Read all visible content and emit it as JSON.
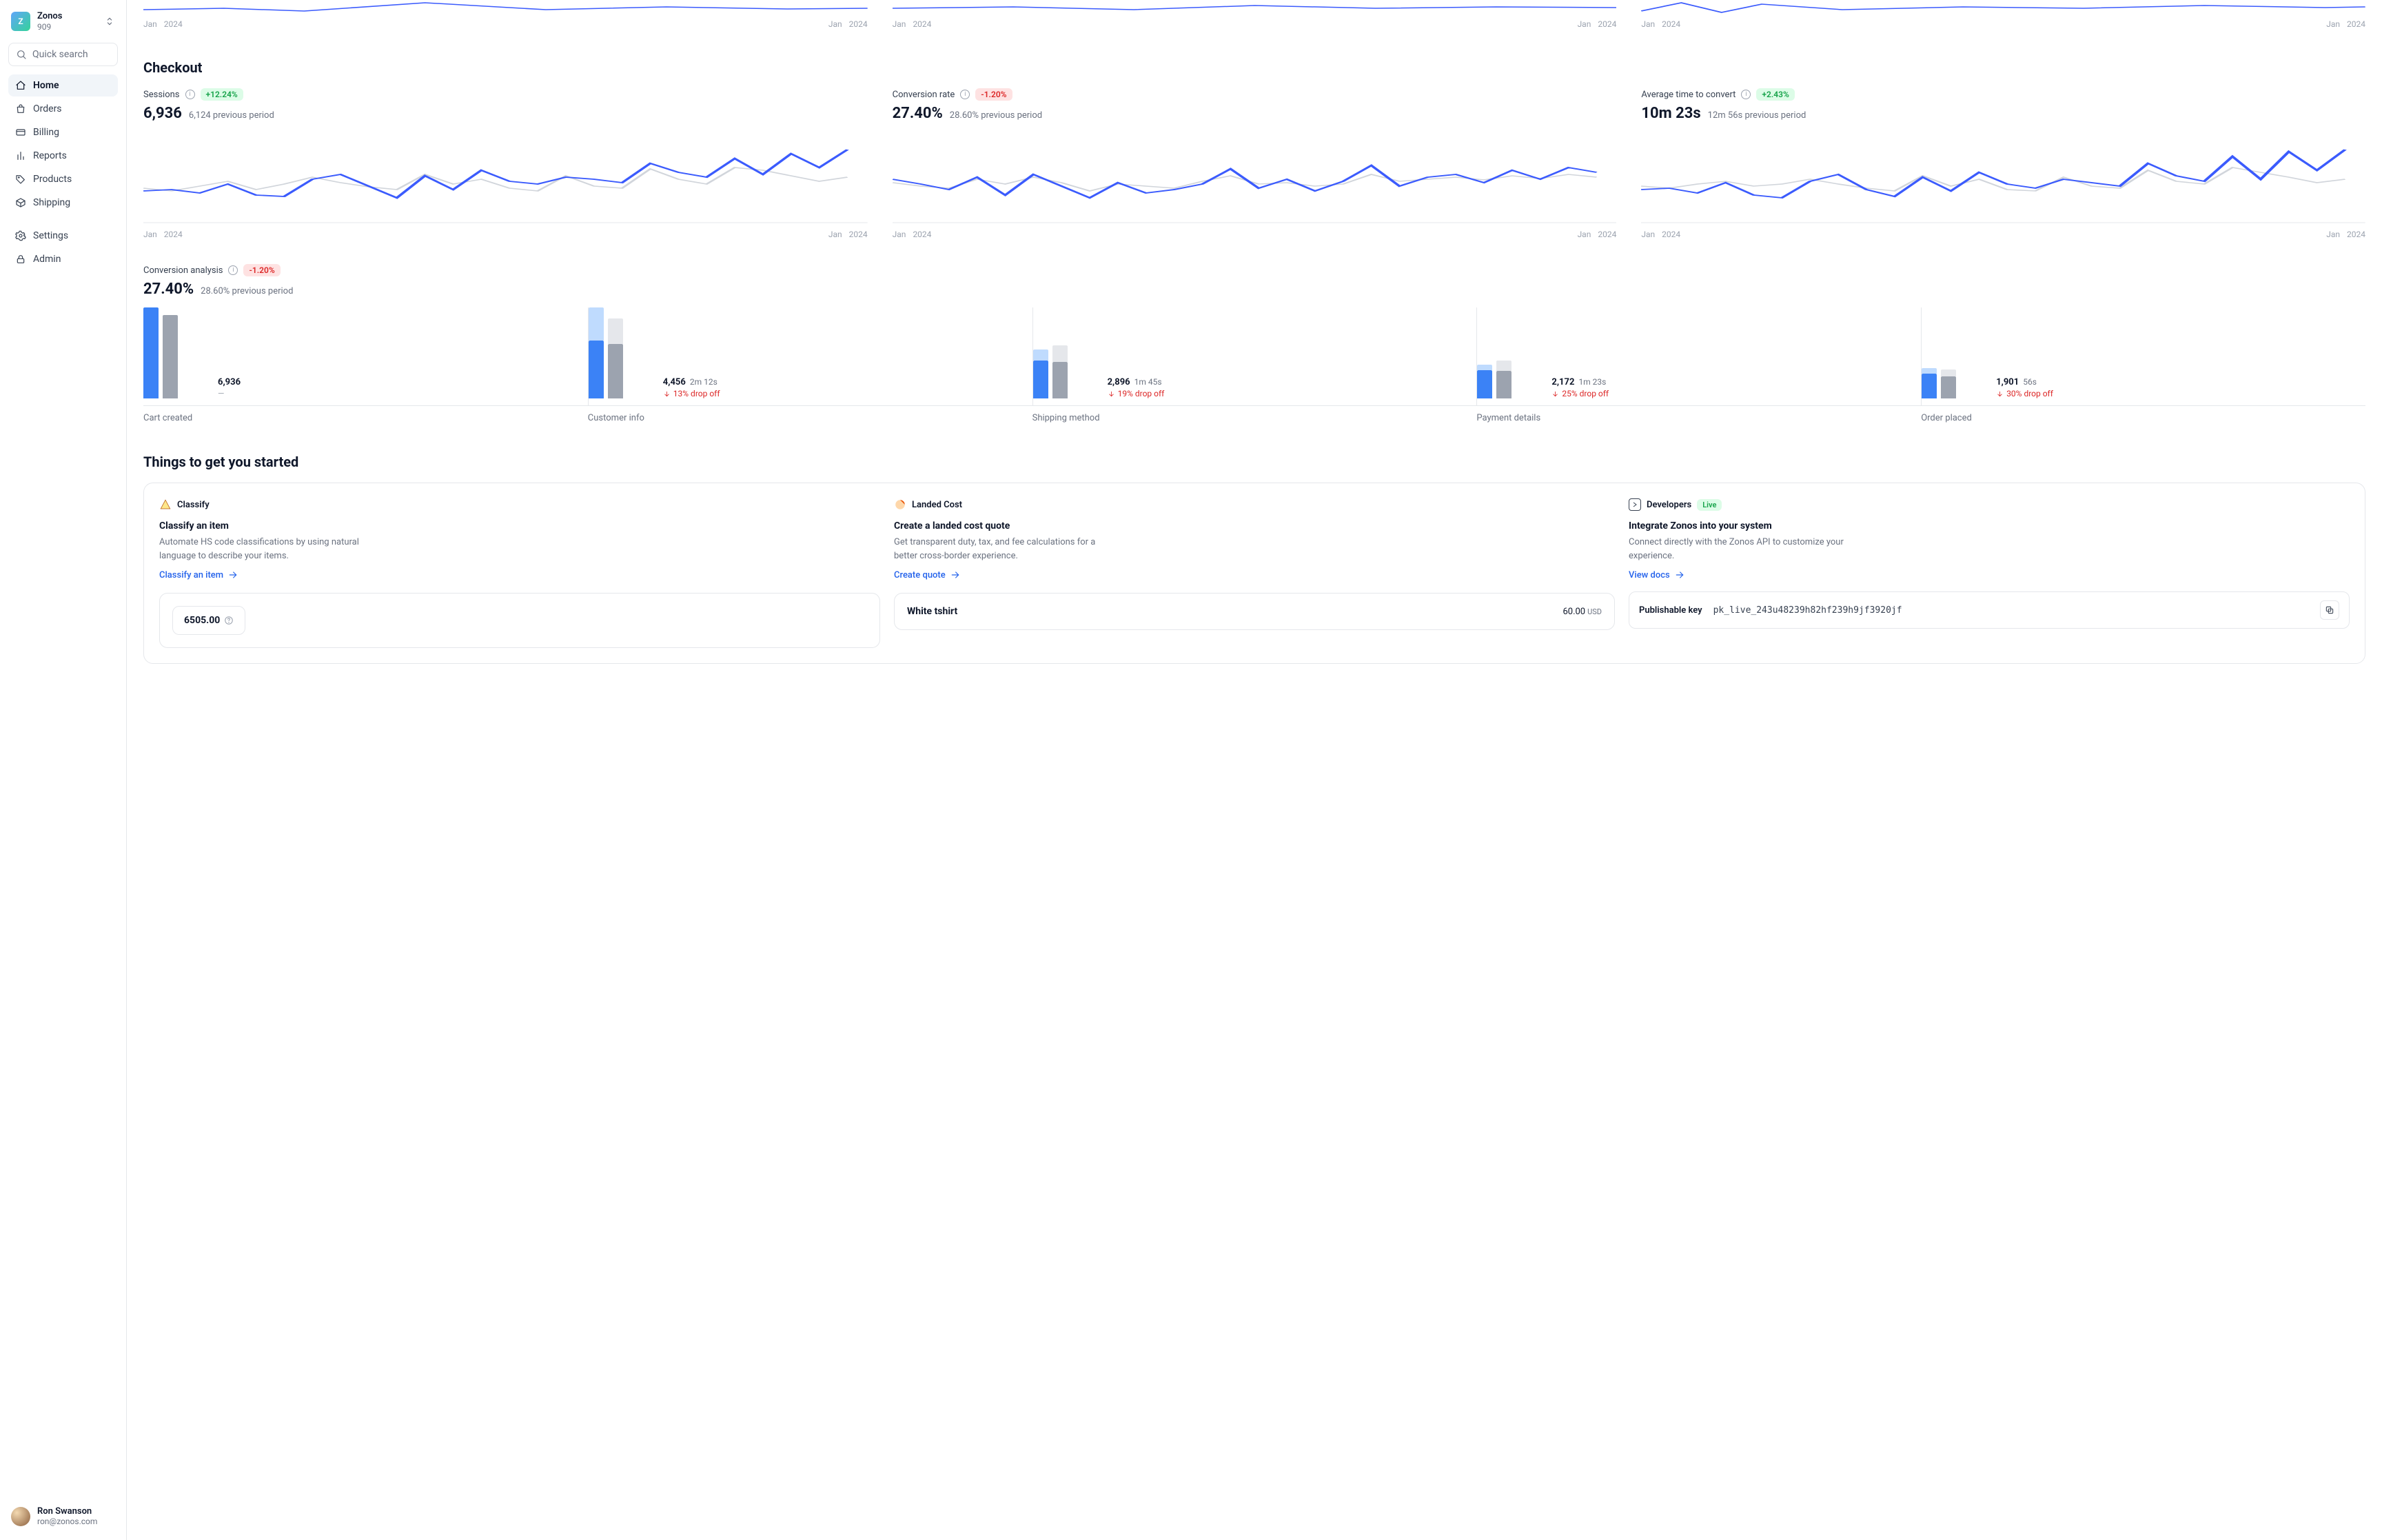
{
  "org": {
    "name": "Zonos",
    "id": "909",
    "initial": "Z"
  },
  "search": {
    "placeholder": "Quick search"
  },
  "nav": {
    "home": "Home",
    "orders": "Orders",
    "billing": "Billing",
    "reports": "Reports",
    "products": "Products",
    "shipping": "Shipping",
    "settings": "Settings",
    "admin": "Admin"
  },
  "user": {
    "name": "Ron Swanson",
    "email": "ron@zonos.com"
  },
  "dates": {
    "left_month": "Jan",
    "left_year": "2024",
    "right_month": "Jan",
    "right_year": "2024"
  },
  "checkout": {
    "title": "Checkout",
    "sessions": {
      "label": "Sessions",
      "delta": "+12.24%",
      "delta_type": "pos",
      "value": "6,936",
      "prev": "6,124 previous period"
    },
    "conversion": {
      "label": "Conversion rate",
      "delta": "-1.20%",
      "delta_type": "neg",
      "value": "27.40%",
      "prev": "28.60% previous period"
    },
    "avg_time": {
      "label": "Average time to convert",
      "delta": "+2.43%",
      "delta_type": "pos",
      "value": "10m 23s",
      "prev": "12m 56s previous period"
    }
  },
  "funnel": {
    "label": "Conversion analysis",
    "delta": "-1.20%",
    "value": "27.40%",
    "prev": "28.60% previous period",
    "steps": [
      {
        "label": "Cart created",
        "value": "6,936",
        "time": "",
        "drop": "",
        "cur_h": 100,
        "cur_top": 0,
        "prev_h": 92,
        "prev_top": 0
      },
      {
        "label": "Customer info",
        "value": "4,456",
        "time": "2m 12s",
        "drop": "13% drop off",
        "cur_h": 64,
        "cur_top": 36,
        "prev_h": 60,
        "prev_top": 28
      },
      {
        "label": "Shipping method",
        "value": "2,896",
        "time": "1m 45s",
        "drop": "19% drop off",
        "cur_h": 42,
        "cur_top": 12,
        "prev_h": 40,
        "prev_top": 18
      },
      {
        "label": "Payment details",
        "value": "2,172",
        "time": "1m 23s",
        "drop": "25% drop off",
        "cur_h": 31,
        "cur_top": 6,
        "prev_h": 30,
        "prev_top": 12
      },
      {
        "label": "Order placed",
        "value": "1,901",
        "time": "56s",
        "drop": "30% drop off",
        "cur_h": 27,
        "cur_top": 6,
        "prev_h": 24,
        "prev_top": 8
      }
    ]
  },
  "things": {
    "title": "Things to get you started",
    "classify": {
      "tag": "Classify",
      "title": "Classify an item",
      "desc": "Automate HS code classifications by using natural language to describe your items.",
      "link": "Classify an item",
      "preview_amount": "6505.00"
    },
    "landed": {
      "tag": "Landed Cost",
      "title": "Create a landed cost quote",
      "desc": "Get transparent duty, tax, and fee calculations for a better cross-border experience.",
      "link": "Create quote",
      "item_name": "White tshirt",
      "item_price": "60.00",
      "item_currency": "USD"
    },
    "dev": {
      "tag": "Developers",
      "live": "Live",
      "title": "Integrate Zonos into your system",
      "desc": "Connect directly with the Zonos API to customize your experience.",
      "link": "View docs",
      "key_label": "Publishable key",
      "key_value": "pk_live_243u48239h82hf239h9jf3920jf"
    }
  },
  "chart_data": [
    {
      "type": "line",
      "title": "Sessions",
      "x_range": [
        "Jan 2024",
        "Jan 2024"
      ],
      "series": [
        {
          "name": "current",
          "values": [
            38,
            40,
            35,
            48,
            32,
            30,
            55,
            62,
            45,
            28,
            60,
            40,
            68,
            52,
            48,
            58,
            55,
            50,
            78,
            65,
            58,
            85,
            62,
            92,
            72,
            98
          ]
        },
        {
          "name": "previous",
          "values": [
            42,
            38,
            45,
            52,
            40,
            48,
            58,
            50,
            44,
            40,
            62,
            48,
            55,
            42,
            38,
            60,
            45,
            42,
            70,
            55,
            48,
            72,
            68,
            60,
            52,
            58
          ]
        }
      ]
    },
    {
      "type": "line",
      "title": "Conversion rate",
      "x_range": [
        "Jan 2024",
        "Jan 2024"
      ],
      "series": [
        {
          "name": "current",
          "values": [
            55,
            48,
            40,
            58,
            32,
            62,
            45,
            28,
            50,
            35,
            40,
            48,
            70,
            42,
            55,
            38,
            52,
            75,
            45,
            58,
            62,
            50,
            68,
            55,
            72,
            65
          ]
        },
        {
          "name": "previous",
          "values": [
            50,
            45,
            42,
            55,
            48,
            58,
            50,
            38,
            48,
            45,
            42,
            52,
            60,
            48,
            50,
            45,
            48,
            62,
            52,
            55,
            58,
            54,
            60,
            56,
            62,
            58
          ]
        }
      ]
    },
    {
      "type": "line",
      "title": "Average time to convert",
      "x_range": [
        "Jan 2024",
        "Jan 2024"
      ],
      "series": [
        {
          "name": "current",
          "values": [
            40,
            42,
            35,
            50,
            32,
            28,
            52,
            62,
            40,
            30,
            58,
            38,
            65,
            48,
            42,
            55,
            50,
            45,
            78,
            60,
            52,
            88,
            55,
            95,
            68,
            98
          ]
        },
        {
          "name": "previous",
          "values": [
            45,
            42,
            48,
            52,
            45,
            48,
            55,
            48,
            42,
            38,
            60,
            45,
            55,
            40,
            38,
            58,
            45,
            42,
            68,
            52,
            48,
            72,
            65,
            58,
            50,
            55
          ]
        }
      ]
    },
    {
      "type": "bar",
      "title": "Conversion analysis funnel",
      "categories": [
        "Cart created",
        "Customer info",
        "Shipping method",
        "Payment details",
        "Order placed"
      ],
      "series": [
        {
          "name": "current",
          "values": [
            6936,
            4456,
            2896,
            2172,
            1901
          ]
        },
        {
          "name": "drop_off_pct",
          "values": [
            0,
            13,
            19,
            25,
            30
          ]
        },
        {
          "name": "time",
          "values": [
            "",
            "2m 12s",
            "1m 45s",
            "1m 23s",
            "56s"
          ]
        }
      ]
    }
  ]
}
